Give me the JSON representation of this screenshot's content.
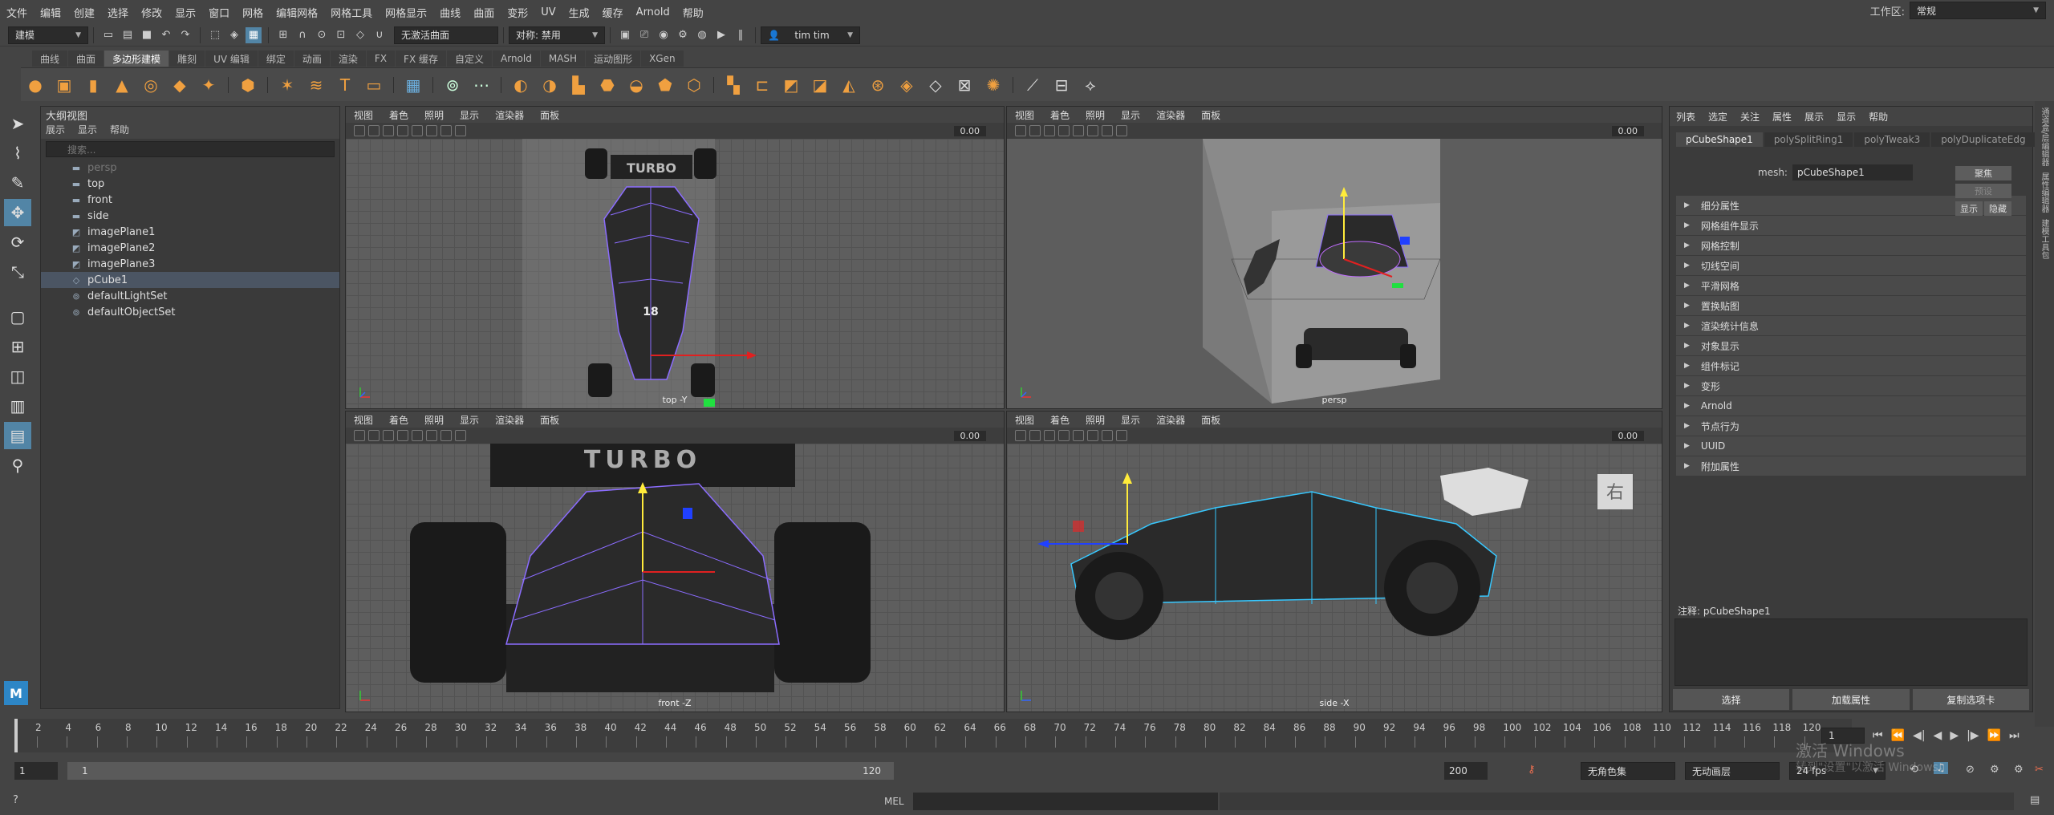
{
  "menubar": {
    "items": [
      "文件",
      "编辑",
      "创建",
      "选择",
      "修改",
      "显示",
      "窗口",
      "网格",
      "编辑网格",
      "网格工具",
      "网格显示",
      "曲线",
      "曲面",
      "变形",
      "UV",
      "生成",
      "缓存",
      "Arnold",
      "帮助"
    ],
    "workspace_label": "工作区:",
    "workspace_value": "常规"
  },
  "statusline": {
    "mode": "建模",
    "live_surface": "无激活曲面",
    "symmetry_label": "对称: 禁用",
    "user": "tim tim"
  },
  "shelf": {
    "tabs": [
      "曲线",
      "曲面",
      "多边形建模",
      "雕刻",
      "UV 编辑",
      "绑定",
      "动画",
      "渲染",
      "FX",
      "FX 缓存",
      "自定义",
      "Arnold",
      "MASH",
      "运动图形",
      "XGen"
    ],
    "active_tab": "多边形建模"
  },
  "outliner": {
    "title": "大纲视图",
    "menu": [
      "展示",
      "显示",
      "帮助"
    ],
    "search_placeholder": "搜索...",
    "items": [
      {
        "label": "persp",
        "icon": "camera-icon"
      },
      {
        "label": "top",
        "icon": "camera-icon"
      },
      {
        "label": "front",
        "icon": "camera-icon"
      },
      {
        "label": "side",
        "icon": "camera-icon"
      },
      {
        "label": "imagePlane1",
        "icon": "image-plane-icon"
      },
      {
        "label": "imagePlane2",
        "icon": "image-plane-icon"
      },
      {
        "label": "imagePlane3",
        "icon": "image-plane-icon"
      },
      {
        "label": "pCube1",
        "icon": "mesh-icon"
      },
      {
        "label": "defaultLightSet",
        "icon": "set-icon"
      },
      {
        "label": "defaultObjectSet",
        "icon": "set-icon"
      }
    ]
  },
  "viewport": {
    "menu": [
      "视图",
      "着色",
      "照明",
      "显示",
      "渲染器",
      "面板"
    ],
    "value": "0.00",
    "panels": [
      {
        "label": "top -Y"
      },
      {
        "label": "persp"
      },
      {
        "label": "front -Z"
      },
      {
        "label": "side -X"
      }
    ],
    "text_turbo": "TURBO",
    "text_number": "18",
    "text_right": "右"
  },
  "attr_editor": {
    "menu": [
      "列表",
      "选定",
      "关注",
      "属性",
      "展示",
      "显示",
      "帮助"
    ],
    "tabs": [
      "pCubeShape1",
      "polySplitRing1",
      "polyTweak3",
      "polyDuplicateEdg"
    ],
    "mesh_label": "mesh:",
    "mesh_value": "pCubeShape1",
    "btn_focus": "聚焦",
    "btn_preset": "预设",
    "btn_show": "显示",
    "btn_hide": "隐藏",
    "sections": [
      "细分属性",
      "网格组件显示",
      "网格控制",
      "切线空间",
      "平滑网格",
      "置换贴图",
      "渲染统计信息",
      "对象显示",
      "组件标记",
      "变形",
      "Arnold",
      "节点行为",
      "UUID",
      "附加属性"
    ],
    "notes_label": "注释: pCubeShape1",
    "bottom_buttons": [
      "选择",
      "加载属性",
      "复制选项卡"
    ]
  },
  "right_strip": [
    "通道盒/层编辑器",
    "属性编辑器",
    "建模工具包"
  ],
  "timeline": {
    "ticks": [
      "2",
      "4",
      "6",
      "8",
      "10",
      "12",
      "14",
      "16",
      "18",
      "20",
      "22",
      "24",
      "26",
      "28",
      "30",
      "32",
      "34",
      "36",
      "38",
      "40",
      "42",
      "44",
      "46",
      "48",
      "50",
      "52",
      "54",
      "56",
      "58",
      "60",
      "62",
      "64",
      "66",
      "68",
      "70",
      "72",
      "74",
      "76",
      "78",
      "80",
      "82",
      "84",
      "86",
      "88",
      "90",
      "92",
      "94",
      "96",
      "98",
      "100",
      "102",
      "104",
      "106",
      "108",
      "110",
      "112",
      "114",
      "116",
      "118",
      "120"
    ],
    "current_frame": "1"
  },
  "range": {
    "start": "1",
    "inner_start": "1",
    "inner_end": "120",
    "end": "200",
    "character_set": "无角色集",
    "anim_layer": "无动画层",
    "fps": "24 fps"
  },
  "cmdline": {
    "label": "MEL"
  },
  "watermark": {
    "line1": "激活 Windows",
    "line2": "转到\"设置\"以激活 Windows。"
  }
}
